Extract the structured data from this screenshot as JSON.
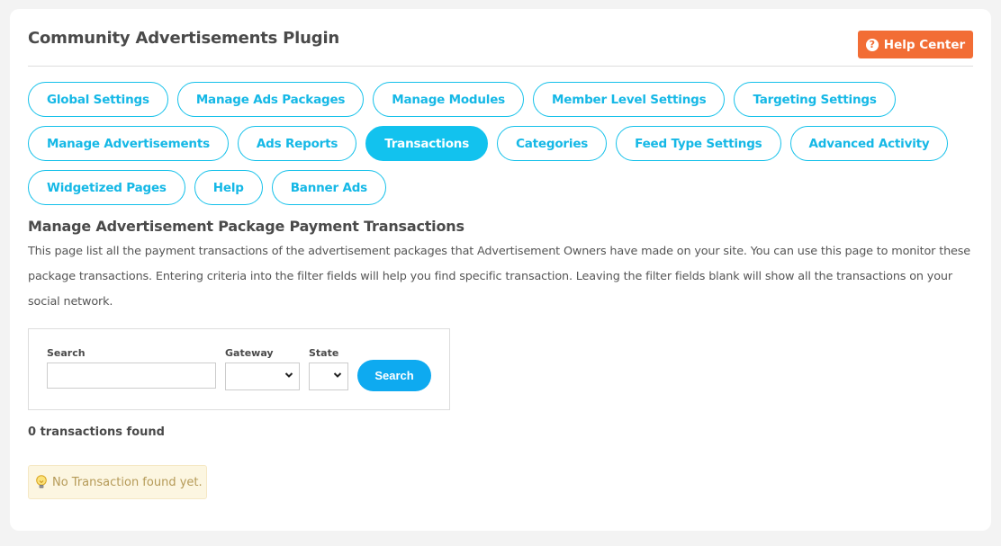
{
  "header": {
    "title": "Community Advertisements Plugin",
    "help_center_label": "Help Center",
    "help_center_icon": "question-circle-icon"
  },
  "tabs": [
    {
      "label": "Global Settings",
      "active": false
    },
    {
      "label": "Manage Ads Packages",
      "active": false
    },
    {
      "label": "Manage Modules",
      "active": false
    },
    {
      "label": "Member Level Settings",
      "active": false
    },
    {
      "label": "Targeting Settings",
      "active": false
    },
    {
      "label": "Manage Advertisements",
      "active": false
    },
    {
      "label": "Ads Reports",
      "active": false
    },
    {
      "label": "Transactions",
      "active": true
    },
    {
      "label": "Categories",
      "active": false
    },
    {
      "label": "Feed Type Settings",
      "active": false
    },
    {
      "label": "Advanced Activity",
      "active": false
    },
    {
      "label": "Widgetized Pages",
      "active": false
    },
    {
      "label": "Help",
      "active": false
    },
    {
      "label": "Banner Ads",
      "active": false
    }
  ],
  "section": {
    "title": "Manage Advertisement Package Payment Transactions",
    "description": "This page list all the payment transactions of the advertisement packages that Advertisement Owners have made on your site. You can use this page to monitor these package transactions. Entering criteria into the filter fields will help you find specific transaction. Leaving the filter fields blank will show all the transactions on your social network."
  },
  "filter": {
    "search_label": "Search",
    "search_value": "",
    "gateway_label": "Gateway",
    "gateway_value": "",
    "state_label": "State",
    "state_value": "",
    "submit_label": "Search"
  },
  "results": {
    "count_text": "0 transactions found",
    "empty_message": "No Transaction found yet.",
    "empty_icon": "lightbulb-icon"
  },
  "colors": {
    "accent": "#12c2ee",
    "help_button": "#f26d35",
    "search_button": "#0eaaf0",
    "notice_bg": "#fcf6e1"
  }
}
